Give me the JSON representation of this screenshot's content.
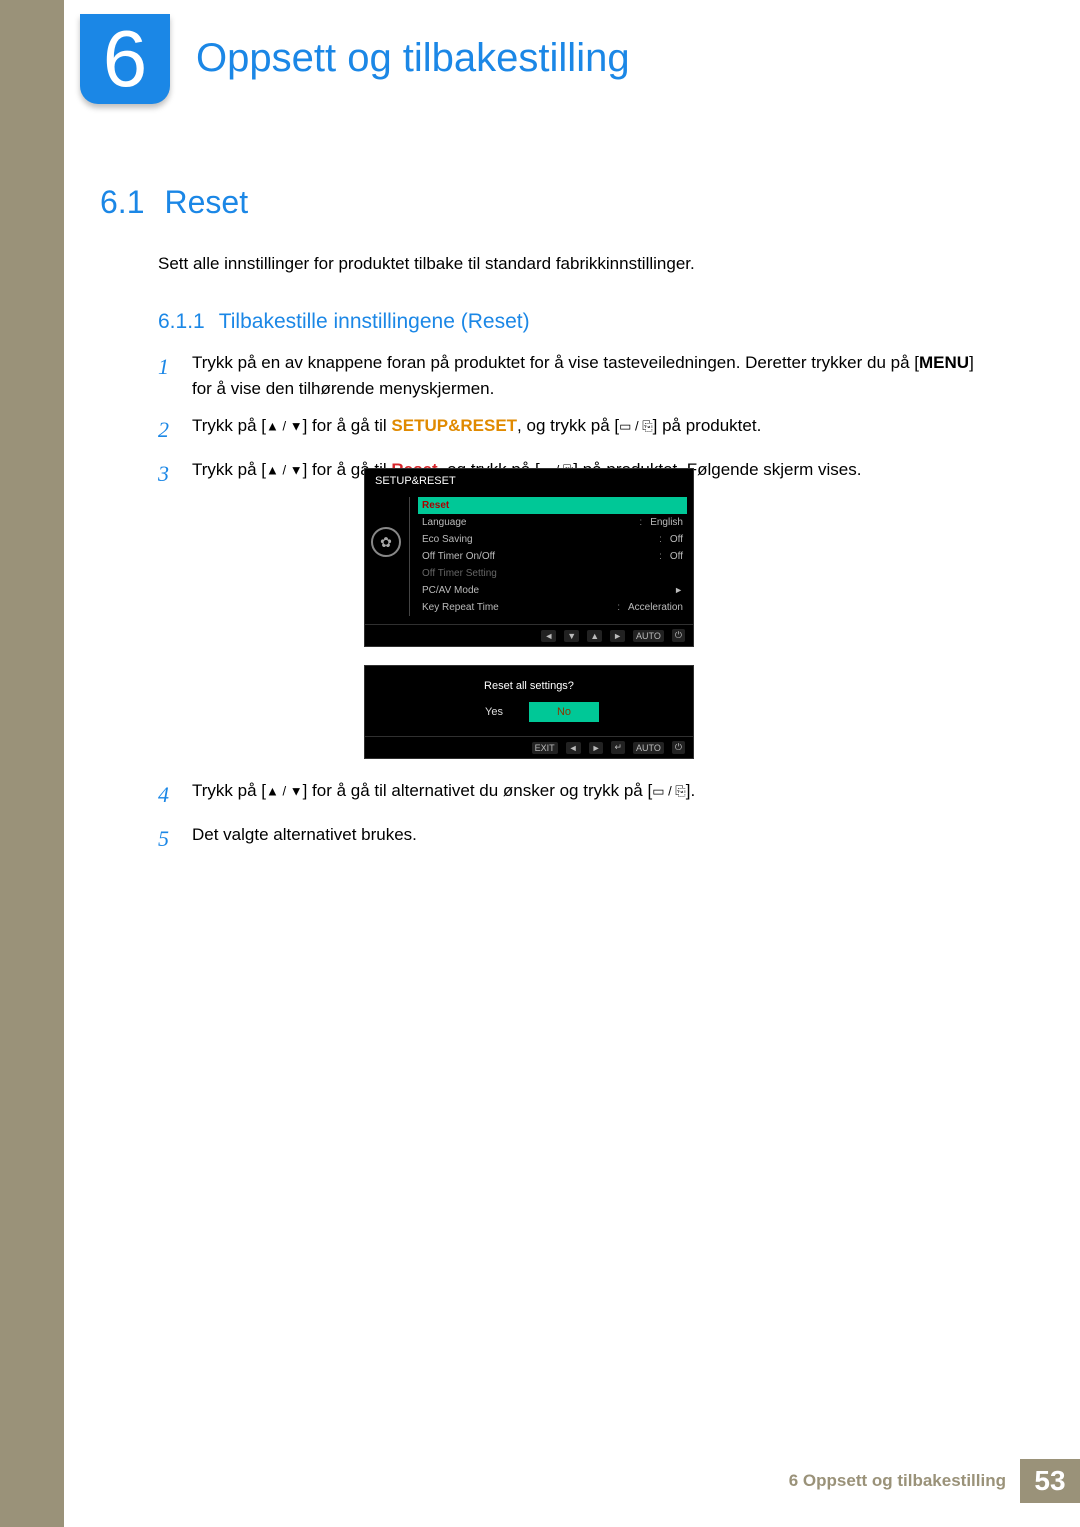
{
  "chapter": {
    "number": "6",
    "title": "Oppsett og tilbakestilling"
  },
  "section": {
    "number": "6.1",
    "title": "Reset",
    "desc": "Sett alle innstillinger for produktet tilbake til standard fabrikkinnstillinger."
  },
  "subsection": {
    "number": "6.1.1",
    "title": "Tilbakestille innstillingene (Reset)"
  },
  "steps": {
    "s1a": "Trykk på en av knappene foran på produktet for å vise tasteveiledningen. Deretter trykker du på [",
    "s1b": "] for å vise den tilhørende menyskjermen.",
    "menu_label": "MENU",
    "s2a": "Trykk på [",
    "s2b": "] for å gå til ",
    "s2c": ", og trykk på [",
    "s2d": "] på produktet.",
    "setup_reset": "SETUP&RESET",
    "s3a": "Trykk på [",
    "s3b": "] for å gå til ",
    "s3c": ", og trykk på [",
    "s3d": "] på produktet. Følgende skjerm vises.",
    "reset_word": "Reset",
    "s4a": "Trykk på [",
    "s4b": "] for å gå til alternativet du ønsker og trykk på [",
    "s4c": "].",
    "s5": "Det valgte alternativet brukes."
  },
  "osd": {
    "title": "SETUP&RESET",
    "items": [
      {
        "label": "Reset",
        "value": "",
        "sel": true
      },
      {
        "label": "Language",
        "value": "English"
      },
      {
        "label": "Eco Saving",
        "value": "Off"
      },
      {
        "label": "Off Timer On/Off",
        "value": "Off"
      },
      {
        "label": "Off Timer Setting",
        "value": "",
        "dim": true
      },
      {
        "label": "PC/AV Mode",
        "value": "",
        "arrow": true
      },
      {
        "label": "Key Repeat Time",
        "value": "Acceleration"
      }
    ],
    "footer": [
      "◄",
      "▼",
      "▲",
      "►",
      "AUTO",
      "⏻"
    ],
    "prompt": "Reset all settings?",
    "yes": "Yes",
    "no": "No",
    "footer2": [
      "EXIT",
      "◄",
      "►",
      "↵",
      "AUTO",
      "⏻"
    ]
  },
  "footer": {
    "text": "6 Oppsett og tilbakestilling",
    "page": "53"
  },
  "glyph": {
    "updown": "▲ / ▼",
    "enter": "▭ / ⎘"
  }
}
